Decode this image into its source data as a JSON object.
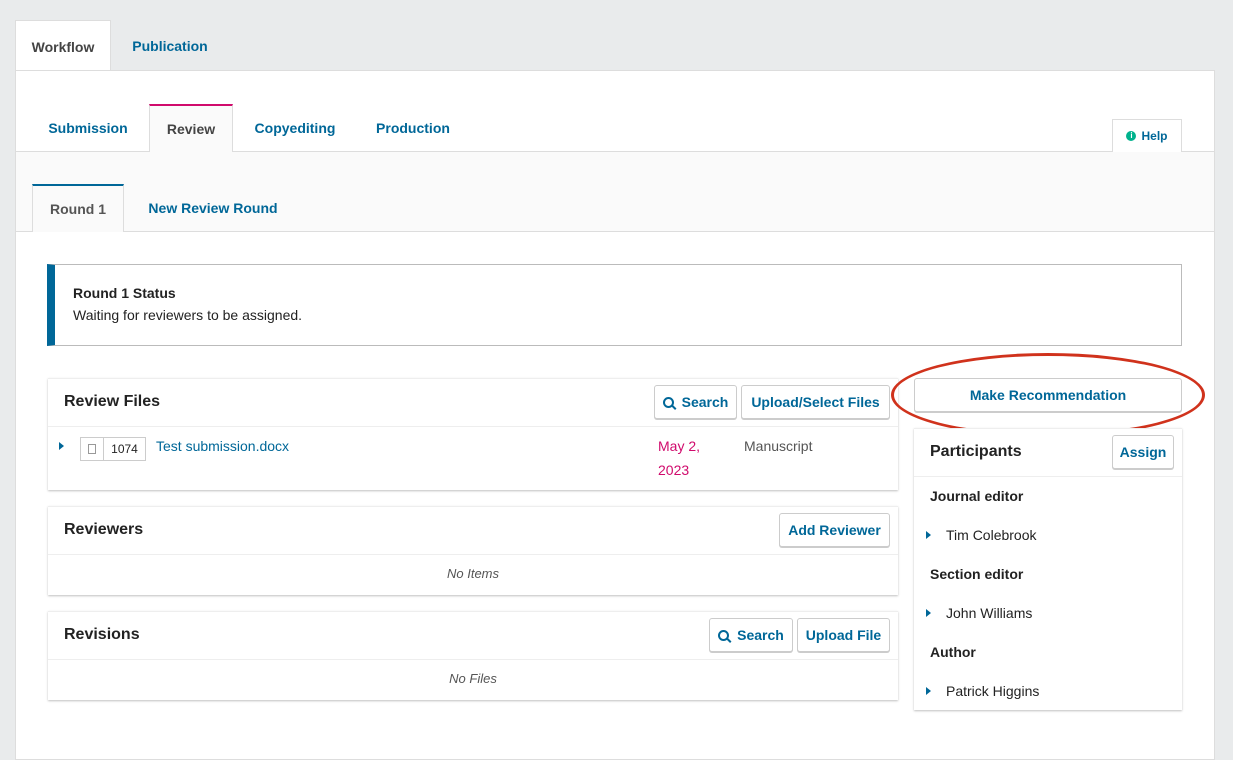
{
  "top_tabs": {
    "workflow": "Workflow",
    "publication": "Publication"
  },
  "stage_tabs": {
    "submission": "Submission",
    "review": "Review",
    "copyediting": "Copyediting",
    "production": "Production"
  },
  "help": {
    "label": "Help",
    "icon": "info-icon"
  },
  "round_tabs": {
    "round1": "Round 1",
    "new_round": "New Review Round"
  },
  "status": {
    "title": "Round 1 Status",
    "text": "Waiting for reviewers to be assigned."
  },
  "review_files": {
    "title": "Review Files",
    "search_label": "Search",
    "upload_label": "Upload/Select Files",
    "file": {
      "id": "1074",
      "name": "Test submission.docx",
      "date_line1": "May 2,",
      "date_line2": "2023",
      "type": "Manuscript"
    }
  },
  "reviewers": {
    "title": "Reviewers",
    "add_label": "Add Reviewer",
    "empty": "No Items"
  },
  "revisions": {
    "title": "Revisions",
    "search_label": "Search",
    "upload_label": "Upload File",
    "empty": "No Files"
  },
  "make_recommendation": "Make Recommendation",
  "participants": {
    "title": "Participants",
    "assign_label": "Assign",
    "groups": [
      {
        "role": "Journal editor",
        "name": "Tim Colebrook"
      },
      {
        "role": "Section editor",
        "name": "John Williams"
      },
      {
        "role": "Author",
        "name": "Patrick Higgins"
      }
    ]
  },
  "colors": {
    "accent": "#006798",
    "active_stage": "#d00a6c",
    "date": "#d00a6c",
    "annotation": "#d0321c"
  }
}
